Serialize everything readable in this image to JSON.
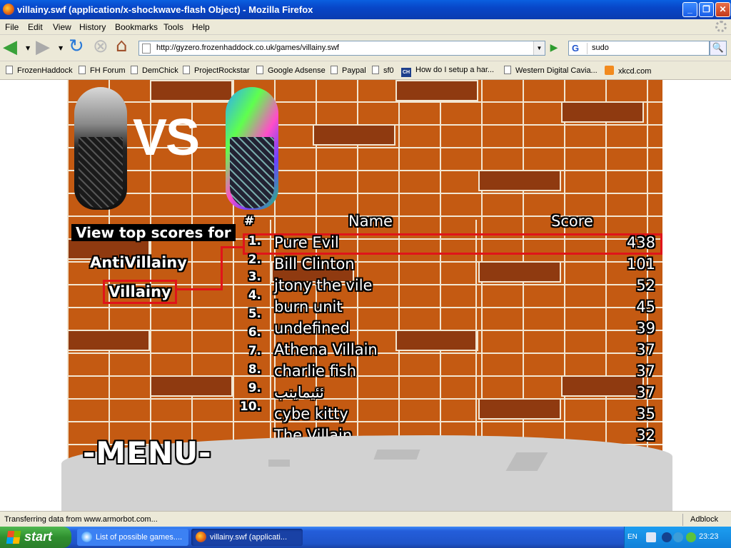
{
  "window": {
    "title": "villainy.swf (application/x-shockwave-flash Object) - Mozilla Firefox",
    "controls": {
      "minimize": "_",
      "maximize": "❐",
      "close": "✕"
    }
  },
  "menubar": {
    "items": [
      "File",
      "Edit",
      "View",
      "History",
      "Bookmarks",
      "Tools",
      "Help"
    ]
  },
  "navbar": {
    "url": "http://gyzero.frozenhaddock.co.uk/games/villainy.swf",
    "search_engine": "G",
    "search_value": "sudo"
  },
  "bookmarks": [
    {
      "label": "FrozenHaddock",
      "icon": "page-icon"
    },
    {
      "label": "FH Forum",
      "icon": "page-icon"
    },
    {
      "label": "DemChick",
      "icon": "page-icon"
    },
    {
      "label": "ProjectRockstar",
      "icon": "page-icon"
    },
    {
      "label": "Google Adsense",
      "icon": "page-icon"
    },
    {
      "label": "Paypal",
      "icon": "page-icon"
    },
    {
      "label": "sf0",
      "icon": "page-icon"
    },
    {
      "label": "How do I setup a har...",
      "icon": "ch-icon",
      "badge": "CH"
    },
    {
      "label": "Western Digital Cavia...",
      "icon": "page-icon"
    },
    {
      "label": "xkcd.com",
      "icon": "rss-icon"
    }
  ],
  "game": {
    "vs_text": "VS",
    "view_top_label": "View top scores for",
    "filters": [
      "AntiVillainy",
      "Villainy"
    ],
    "selected_filter": "Villainy",
    "headers": {
      "rank": "#",
      "name": "Name",
      "score": "Score"
    },
    "ranks": [
      "1.",
      "2.",
      "3.",
      "4.",
      "5.",
      "6.",
      "7.",
      "8.",
      "9.",
      "10."
    ],
    "scores": [
      {
        "name": "Pure Evil",
        "score": "438"
      },
      {
        "name": "Bill Clinton",
        "score": "101"
      },
      {
        "name": "jtony the vile",
        "score": "52"
      },
      {
        "name": "burn unit",
        "score": "45"
      },
      {
        "name": "undefined",
        "score": "39"
      },
      {
        "name": "Athena Villain",
        "score": "37"
      },
      {
        "name": "charlie fish",
        "score": "37"
      },
      {
        "name": "ئئيماينب",
        "score": "37"
      },
      {
        "name": "cybe kitty",
        "score": "35"
      },
      {
        "name": "The Villain",
        "score": "32"
      }
    ],
    "menu_label": "-MENU-"
  },
  "statusbar": {
    "status": "Transferring data from www.armorbot.com...",
    "addon": "Adblock"
  },
  "taskbar": {
    "start_label": "start",
    "tasks": [
      "List of possible games....",
      "villainy.swf (applicati..."
    ],
    "language": "EN",
    "clock": "23:23"
  },
  "colors": {
    "highlight_red": "#e0141a",
    "brick": "#c45a12",
    "brick_dark": "#8f3a10",
    "xp_blue": "#245edb"
  }
}
